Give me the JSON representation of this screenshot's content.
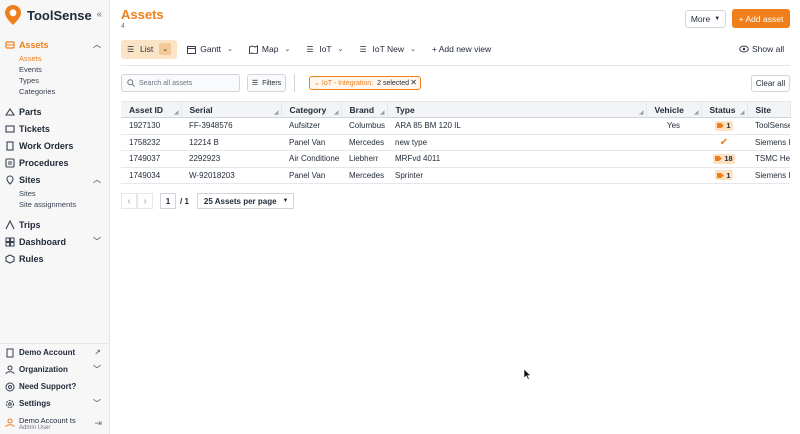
{
  "brand": {
    "name": "ToolSense",
    "accent": "#ee7f1b"
  },
  "sidebar": {
    "collapse_glyph": "«",
    "items": [
      {
        "label": "Assets",
        "icon": "assets-icon",
        "active": true
      },
      {
        "label": "Parts",
        "icon": "parts-icon"
      },
      {
        "label": "Tickets",
        "icon": "tickets-icon"
      },
      {
        "label": "Work Orders",
        "icon": "work-orders-icon"
      },
      {
        "label": "Procedures",
        "icon": "procedures-icon"
      },
      {
        "label": "Sites",
        "icon": "sites-icon"
      },
      {
        "label": "Trips",
        "icon": "trips-icon"
      },
      {
        "label": "Dashboard",
        "icon": "dashboard-icon"
      },
      {
        "label": "Rules",
        "icon": "rules-icon"
      }
    ],
    "assets_sub": [
      "Assets",
      "Events",
      "Types",
      "Categories"
    ],
    "sites_sub": [
      "Sites",
      "Site assignments"
    ],
    "bottom": [
      {
        "label": "Demo Account",
        "icon": "building-icon"
      },
      {
        "label": "Organization",
        "icon": "organization-icon"
      },
      {
        "label": "Need Support?",
        "icon": "support-icon"
      },
      {
        "label": "Settings",
        "icon": "gear-icon"
      }
    ],
    "user": {
      "name": "Demo Account ts",
      "role": "Admin User"
    }
  },
  "header": {
    "title": "Assets",
    "count": "4",
    "more_label": "More",
    "add_label": "+ Add asset"
  },
  "views": {
    "tabs": [
      "List",
      "Gantt",
      "Map",
      "IoT",
      "IoT New"
    ],
    "add_label": "+ Add new view",
    "show_all_label": "Show all"
  },
  "toolbar": {
    "search_placeholder": "Search all assets",
    "filters_label": "Filters",
    "chip_label": "IoT - Integration:",
    "chip_value": "2 selected",
    "clear_label": "Clear all"
  },
  "table": {
    "columns": [
      "Asset ID",
      "Serial",
      "Category",
      "Brand",
      "Type",
      "Vehicle",
      "Status",
      "Site"
    ],
    "rows": [
      {
        "id": "1927130",
        "serial": "FF-3948576",
        "category": "Aufsitzer",
        "brand": "Columbus",
        "type": "ARA 85 BM 120 IL",
        "vehicle": "Yes",
        "status": "1",
        "site": "ToolSense"
      },
      {
        "id": "1758232",
        "serial": "12214 B",
        "category": "Panel Van",
        "brand": "Mercedes",
        "type": "new type",
        "vehicle": "",
        "status": "check",
        "site": "Siemens I"
      },
      {
        "id": "1749037",
        "serial": "2292923",
        "category": "Air Conditione",
        "brand": "Liebherr",
        "type": "MRFvd 4011",
        "vehicle": "",
        "status": "18",
        "site": "TSMC Hea"
      },
      {
        "id": "1749034",
        "serial": "W-92018203",
        "category": "Panel Van",
        "brand": "Mercedes",
        "type": "Sprinter",
        "vehicle": "",
        "status": "1",
        "site": "Siemens I"
      }
    ]
  },
  "pager": {
    "page": "1",
    "total": "/ 1",
    "per_page": "25 Assets per page"
  }
}
